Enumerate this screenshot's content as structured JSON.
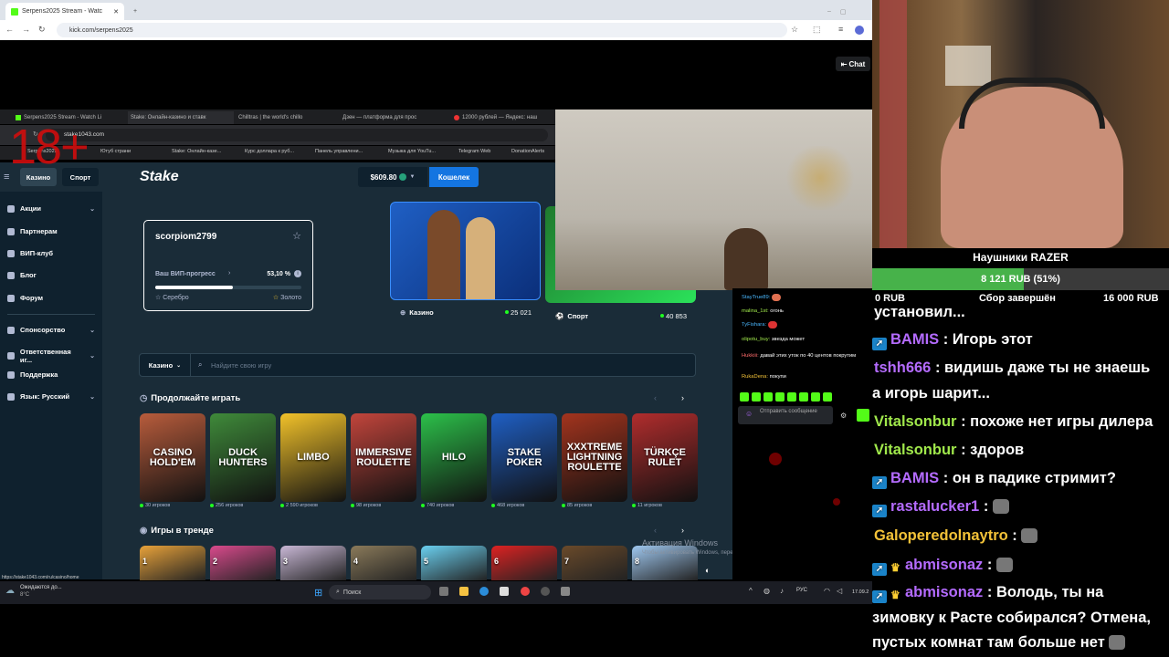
{
  "outer_browser": {
    "tab_title": "Serpens2025 Stream - Watc",
    "url": "kick.com/serpens2025",
    "chat_button": "Chat"
  },
  "inner_browser": {
    "tabs": [
      "Serpens2025 Stream - Watch Li",
      "Stake: Онлайн-казино и ставк",
      "Chilltras | the world's chillo",
      "Дзен — платформа для прос",
      "12000 рублей — Яндекс: наш"
    ],
    "url": "stake1043.com",
    "bookmarks": [
      "Serpens2025",
      "Ютуб страни",
      "Stake: Онлайн-казе...",
      "Курс доллара к руб...",
      "Панель управлени...",
      "Музыка для YouTu...",
      "Telegram Web",
      "DonationAlerts"
    ],
    "age_label": "18+",
    "status_url": "https://stake1043.com/ru/casino/home"
  },
  "stake": {
    "header": {
      "tab_casino": "Казино",
      "tab_sport": "Спорт",
      "logo": "Stake",
      "balance": "$609.80",
      "wallet_button": "Кошелек"
    },
    "sidebar": [
      {
        "label": "Акции",
        "has_chevron": true
      },
      {
        "label": "Партнерам",
        "has_chevron": false
      },
      {
        "label": "ВИП-клуб",
        "has_chevron": false
      },
      {
        "label": "Блог",
        "has_chevron": false
      },
      {
        "label": "Форум",
        "has_chevron": false
      },
      {
        "label": "Спонсорство",
        "has_chevron": true
      },
      {
        "label": "Ответственная иг...",
        "has_chevron": true
      },
      {
        "label": "Поддержка",
        "has_chevron": false
      },
      {
        "label": "Язык: Русский",
        "has_chevron": true
      }
    ],
    "vip": {
      "username": "scorpiom2799",
      "progress_label": "Ваш ВИП-прогресс",
      "progress_value": "53,10 %",
      "progress_fraction": 0.531,
      "tier_current": "Серебро",
      "tier_next": "Золото"
    },
    "banners": [
      {
        "label": "Казино",
        "count": "25 021"
      },
      {
        "label": "Спорт",
        "count": "40 853"
      }
    ],
    "search": {
      "category": "Казино",
      "placeholder": "Найдите свою игру"
    },
    "continue_section": "Продолжайте играть",
    "games": [
      {
        "title": "CASINO HOLD'EM",
        "players": "30 игроков",
        "color": "#b85c3c"
      },
      {
        "title": "DUCK HUNTERS",
        "players": "256 игроков",
        "color": "#3f8a3a"
      },
      {
        "title": "LIMBO",
        "players": "2 590 игроков",
        "color": "#f2c22a"
      },
      {
        "title": "IMMERSIVE ROULETTE",
        "players": "98 игроков",
        "color": "#c2453c"
      },
      {
        "title": "HILO",
        "players": "740 игроков",
        "color": "#2cc04a"
      },
      {
        "title": "STAKE POKER",
        "players": "468 игроков",
        "color": "#1f5fc4"
      },
      {
        "title": "XXXTREME LIGHTNING ROULETTE",
        "players": "85 игроков",
        "color": "#a3341e"
      },
      {
        "title": "TÜRKÇE RULET",
        "players": "11 игроков",
        "color": "#b12d2d"
      }
    ],
    "trending_section": "Игры в тренде",
    "trending": [
      "1",
      "2",
      "3",
      "4",
      "5",
      "6",
      "7",
      "8"
    ],
    "watermark_title": "Активация Windows",
    "watermark_text": "Чтобы активировать Windows, перейдите в раздел \"Параметры\"."
  },
  "mini_chat": {
    "messages": [
      {
        "user": "StayTrue89:",
        "text": ""
      },
      {
        "user": "malina_1st:",
        "text": "огонь"
      },
      {
        "user": "TyFishara:",
        "text": ""
      },
      {
        "user": "olipotu_buy:",
        "text": "звезда может"
      },
      {
        "user": "Hukkiii:",
        "text": "давай этих уток по 40 центов покрутим"
      },
      {
        "user": "RukaDena:",
        "text": "покупи"
      }
    ],
    "send_placeholder": "Отправить сообщение"
  },
  "taskbar": {
    "weather_text": "Ожидаются до...",
    "weather_temp": "8°C",
    "search_placeholder": "Поиск",
    "language": "РУС",
    "date": "17.09.2"
  },
  "stream_goal": {
    "title": "Наушники RAZER",
    "current": "8 121 RUB (51%)",
    "fraction": 0.51,
    "min_label": "0 RUB",
    "status": "Сбор завершён",
    "max_label": "16 000 RUB"
  },
  "stream_chat": {
    "partial_top": "установил...",
    "lines": [
      {
        "user": "BAMIS",
        "text": ": Игорь этот",
        "badge": "kick",
        "color": "blue"
      },
      {
        "user": "tshh666",
        "text": ": видишь даже ты не знаешь",
        "badge": "",
        "color": "blue"
      },
      {
        "user": "",
        "text": "а игорь шарит...",
        "badge": "",
        "color": ""
      },
      {
        "user": "Vitalsonbur",
        "text": ": похоже нет игры дилера",
        "badge": "",
        "color": "green"
      },
      {
        "user": "Vitalsonbur",
        "text": ": здоров",
        "badge": "",
        "color": "orange"
      },
      {
        "user": "BAMIS",
        "text": ": он в падике стримит?",
        "badge": "kick",
        "color": "blue"
      },
      {
        "user": "rastalucker1",
        "text": ":",
        "badge": "kick",
        "color": "blue"
      },
      {
        "user": "Galoperedolnaytro",
        "text": ":",
        "badge": "",
        "color": "orange"
      },
      {
        "user": "abmisonaz",
        "text": ":",
        "badge": "kick-crown",
        "color": "blue"
      },
      {
        "user": "abmisonaz",
        "text": ": Володь, ты на",
        "badge": "kick-crown",
        "color": "blue"
      },
      {
        "user": "",
        "text": "зимовку к Расте собирался? Отмена,",
        "badge": "",
        "color": ""
      },
      {
        "user": "",
        "text": "пустых комнат там больше нет",
        "badge": "",
        "color": ""
      }
    ]
  }
}
